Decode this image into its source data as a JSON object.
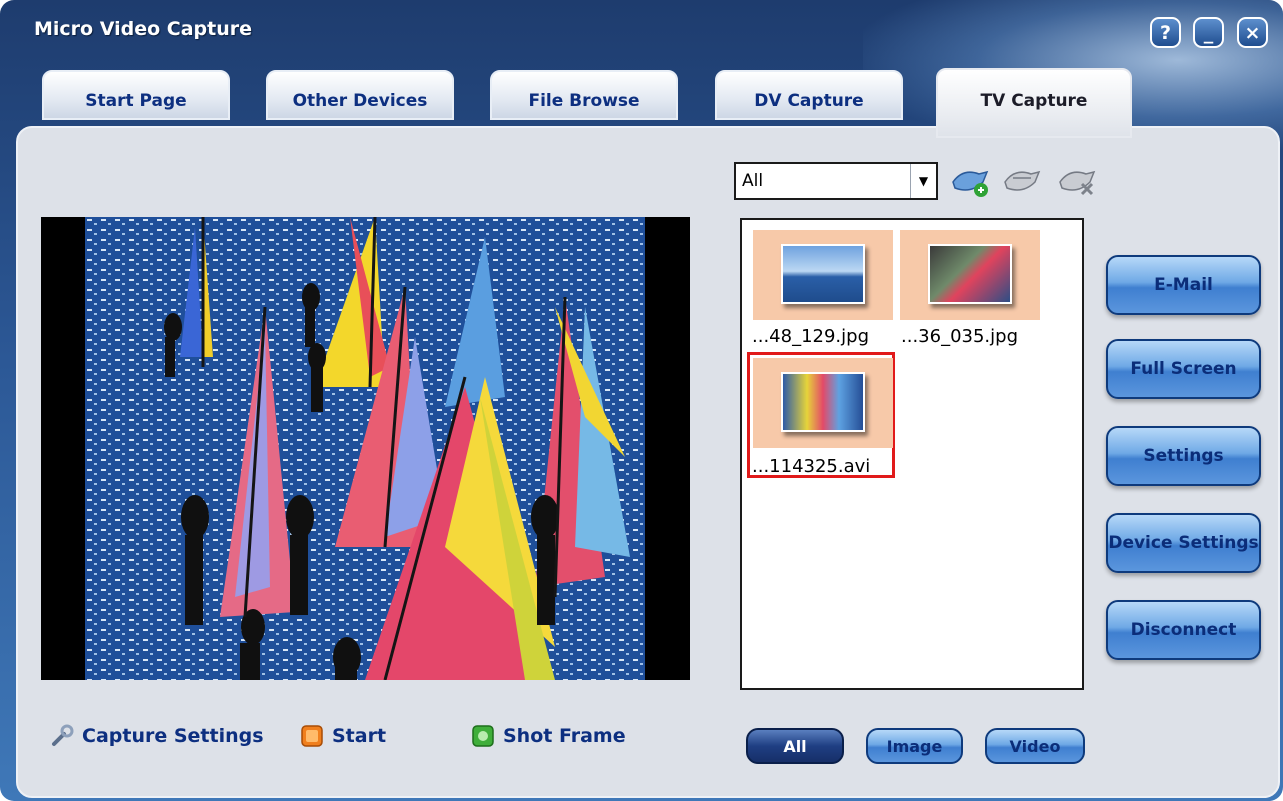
{
  "window": {
    "title": "Micro Video Capture",
    "help_label": "?",
    "minimize_label": "_",
    "close_label": "×"
  },
  "tabs": [
    {
      "label": "Start Page",
      "active": false
    },
    {
      "label": "Other Devices",
      "active": false
    },
    {
      "label": "File Browse",
      "active": false
    },
    {
      "label": "DV Capture",
      "active": false
    },
    {
      "label": "TV Capture",
      "active": true
    }
  ],
  "capture_controls": {
    "settings_label": "Capture Settings",
    "start_label": "Start",
    "shot_label": "Shot Frame"
  },
  "file_filter": {
    "selected": "All",
    "arrow": "▼"
  },
  "toolbar_icons": [
    "add-to-album-icon",
    "export-icon",
    "delete-icon"
  ],
  "files": [
    {
      "name": "...48_129.jpg",
      "type": "image",
      "selected": false
    },
    {
      "name": "...36_035.jpg",
      "type": "image",
      "selected": false
    },
    {
      "name": "...114325.avi",
      "type": "video",
      "selected": true
    }
  ],
  "side_actions": {
    "email": "E-Mail",
    "fullscreen": "Full Screen",
    "settings": "Settings",
    "device_settings": "Device Settings",
    "disconnect": "Disconnect"
  },
  "view_filters": {
    "all": "All",
    "image": "Image",
    "video": "Video",
    "active": "All"
  },
  "colors": {
    "title_bar": "#2c5896",
    "panel": "#dde1e8",
    "selection": "#e11a1a",
    "thumb_bg": "#f7c9a9",
    "button_text": "#0b2d79"
  }
}
